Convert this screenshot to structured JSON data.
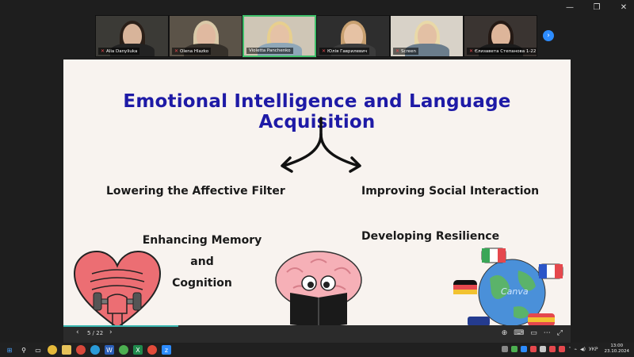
{
  "participants": [
    {
      "name": "Alia Danyliuka",
      "bg": "#3b3a36",
      "hair": "#2a1f18",
      "face": "#d8b49a",
      "body": "#222",
      "muted": true
    },
    {
      "name": "Olena Hlazko",
      "bg": "#5b5348",
      "hair": "#d9c9a8",
      "face": "#e0b9a0",
      "body": "#35302a",
      "muted": true
    },
    {
      "name": "Violetta Panchenko",
      "bg": "#cfc6b6",
      "hair": "#e7cf8e",
      "face": "#e5c2a6",
      "body": "#8fa7b8",
      "muted": false,
      "active": true
    },
    {
      "name": "Юлія Гаврилевич",
      "bg": "#2e2e2e",
      "hair": "#c8a070",
      "face": "#e6c2a4",
      "body": "#3b3b3b",
      "muted": true
    },
    {
      "name": "Screen",
      "bg": "#d8d2c8",
      "hair": "#e9d9a8",
      "face": "#e3c0a4",
      "body": "#6b7d8c",
      "muted": true
    },
    {
      "name": "Єлизавета Степанова 1-22",
      "bg": "#3a3431",
      "hair": "#241914",
      "face": "#ddb59a",
      "body": "#1b1b1b",
      "muted": true
    }
  ],
  "slide": {
    "title": "Emotional Intelligence and Language Acquisition",
    "points": {
      "p1": "Lowering the Affective Filter",
      "p2": "Improving Social Interaction",
      "p3_line1": "Enhancing Memory and",
      "p3_line2": "Cognition",
      "p4": "Developing Resilience"
    },
    "watermark": "Canva"
  },
  "controls": {
    "page_indicator": "5 / 22",
    "progress": 0.2266
  },
  "taskbar": {
    "time": "13:00",
    "date": "23.10.2024",
    "lang": "УКР"
  },
  "colors": {
    "title": "#1e1aa6",
    "slide_bg": "#f8f3ef",
    "heart": "#ec6e73",
    "brain": "#f6b0b7",
    "accent": "#2d8cff"
  }
}
